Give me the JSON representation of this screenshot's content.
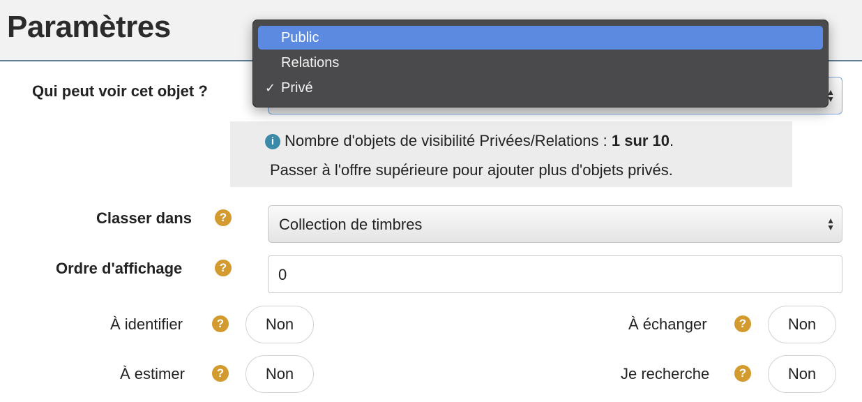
{
  "page": {
    "title": "Paramètres"
  },
  "visibility": {
    "label": "Qui peut voir cet objet ?",
    "options": [
      {
        "label": "Public",
        "highlighted": true,
        "checked": false
      },
      {
        "label": "Relations",
        "highlighted": false,
        "checked": false
      },
      {
        "label": "Privé",
        "highlighted": false,
        "checked": true
      }
    ],
    "selected": "Privé",
    "check_symbol": "✓"
  },
  "info": {
    "icon": "info-icon",
    "line1_prefix": "Nombre d'objets de visibilité Privées/Relations : ",
    "line1_bold": "1 sur 10",
    "line1_suffix": ".",
    "line2": "Passer à l'offre supérieure pour ajouter plus d'objets privés."
  },
  "classer": {
    "label": "Classer dans",
    "value": "Collection de timbres"
  },
  "ordre": {
    "label": "Ordre d'affichage",
    "value": "0"
  },
  "toggles": {
    "identifier": {
      "label": "À identifier",
      "value": "Non"
    },
    "echanger": {
      "label": "À échanger",
      "value": "Non"
    },
    "estimer": {
      "label": "À estimer",
      "value": "Non"
    },
    "recherche": {
      "label": "Je recherche",
      "value": "Non"
    }
  },
  "help_symbol": "?",
  "info_symbol": "i",
  "colors": {
    "help": "#d39a2f",
    "info": "#3a8aa8",
    "menu_bg": "#4a4a4c",
    "menu_highlight": "#5b8ae0",
    "header_rule": "#5f7f95"
  }
}
